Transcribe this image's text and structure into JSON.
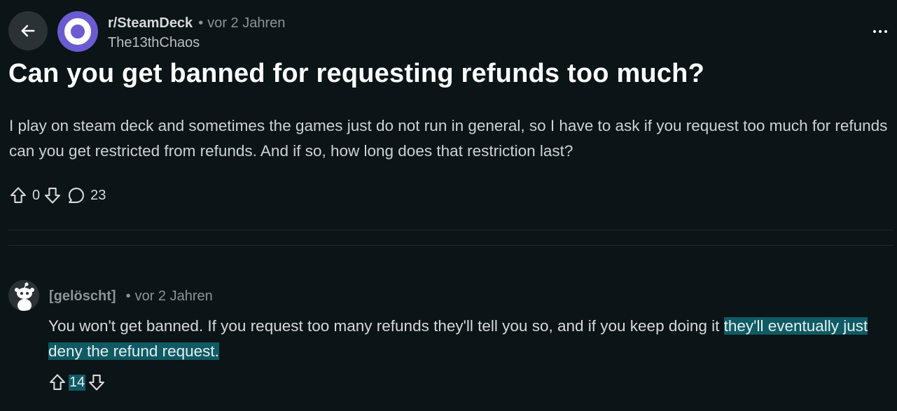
{
  "post": {
    "subreddit": "r/SteamDeck",
    "time": "vor 2 Jahren",
    "author": "The13thChaos",
    "title": "Can you get banned for requesting refunds too much?",
    "body": "I play on steam deck and sometimes the games just do not run in general, so I have to ask if you request too much for refunds can you get restricted from refunds. And if so, how long does that restriction last?",
    "vote_count": "0",
    "comment_count": "23"
  },
  "comment": {
    "author": "[gelöscht]",
    "time": "vor 2 Jahren",
    "body_plain": "You won't get banned. If you request too many refunds they'll tell you so, and if you keep doing it ",
    "body_highlighted": "they'll eventually just deny the refund request. ",
    "vote_count": "14"
  },
  "colors": {
    "background": "#0b1416",
    "highlight": "#0f5a63",
    "subreddit_avatar": "#6b5bd1"
  },
  "icons": [
    "back-arrow-icon",
    "subreddit-icon",
    "more-options-icon",
    "upvote-icon",
    "downvote-icon",
    "comment-icon",
    "snoo-avatar-icon"
  ]
}
